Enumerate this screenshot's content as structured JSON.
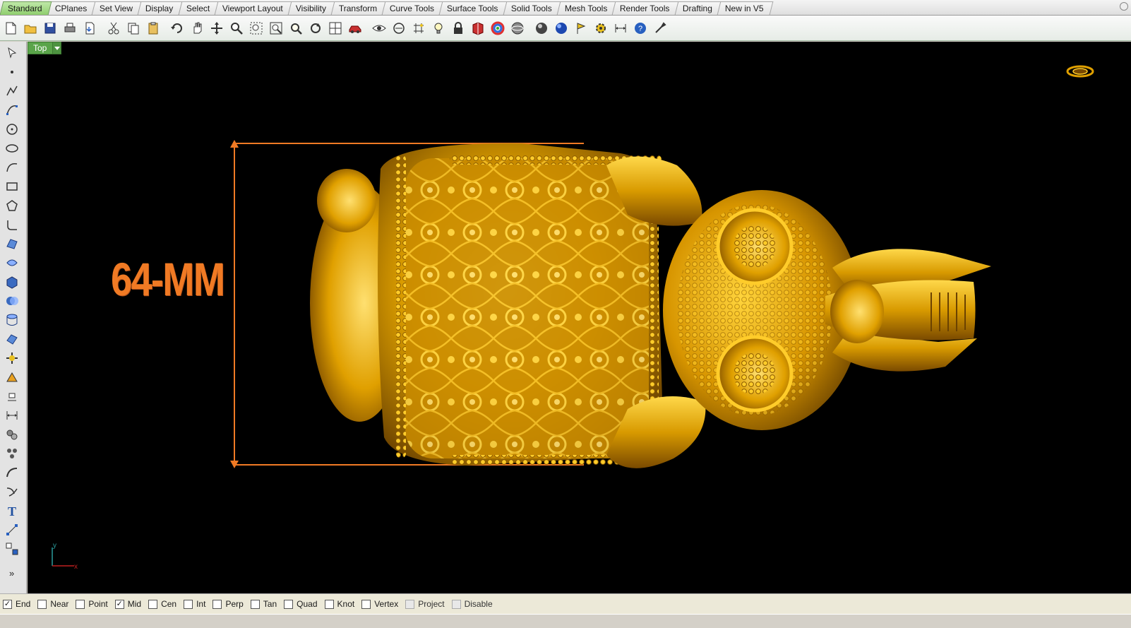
{
  "tabs": [
    {
      "label": "Standard",
      "active": true
    },
    {
      "label": "CPlanes"
    },
    {
      "label": "Set View"
    },
    {
      "label": "Display"
    },
    {
      "label": "Select"
    },
    {
      "label": "Viewport Layout"
    },
    {
      "label": "Visibility"
    },
    {
      "label": "Transform"
    },
    {
      "label": "Curve Tools"
    },
    {
      "label": "Surface Tools"
    },
    {
      "label": "Solid Tools"
    },
    {
      "label": "Mesh Tools"
    },
    {
      "label": "Render Tools"
    },
    {
      "label": "Drafting"
    },
    {
      "label": "New in V5"
    }
  ],
  "toolbar_icons": [
    "new-file-icon",
    "open-folder-icon",
    "save-icon",
    "print-icon",
    "import-icon",
    "cut-icon",
    "copy-icon",
    "paste-icon",
    "undo-icon",
    "pan-hand-icon",
    "move-view-icon",
    "zoom-in-icon",
    "zoom-window-icon",
    "zoom-extents-icon",
    "zoom-selected-icon",
    "rotate-view-icon",
    "four-viewports-icon",
    "car-icon",
    "eye-icon",
    "snap-circle-icon",
    "grid-snap-icon",
    "light-bulb-icon",
    "lock-icon",
    "layer-book-icon",
    "color-wheel-icon",
    "shaded-sphere-icon",
    "rendered-sphere-icon",
    "render-sphere-icon",
    "render-flag-icon",
    "options-gear-icon",
    "dimension-icon",
    "help-icon",
    "tools-icon"
  ],
  "left_tool_icons": [
    "select-arrow-icon",
    "point-icon",
    "polyline-icon",
    "curve-icon",
    "circle-icon",
    "ellipse-icon",
    "arc-icon",
    "rectangle-icon",
    "polygon-icon",
    "fillet-icon",
    "surface-icon",
    "surface-from-curves-icon",
    "box-solid-icon",
    "boolean-icon",
    "extrude-icon",
    "surface-edit-icon",
    "solid-tools-icon",
    "analysis-icon",
    "transform-icon",
    "dimension-icon",
    "group-icon",
    "array-icon",
    "blend-icon",
    "curve-from-object-icon",
    "text-icon",
    "edit-points-icon",
    "block-icon"
  ],
  "left_more_label": "»",
  "viewport": {
    "name": "Top",
    "dimension_label": "64-MM",
    "axis_x": "x",
    "axis_y": "y"
  },
  "osnaps": [
    {
      "label": "End",
      "checked": true
    },
    {
      "label": "Near",
      "checked": false
    },
    {
      "label": "Point",
      "checked": false
    },
    {
      "label": "Mid",
      "checked": true
    },
    {
      "label": "Cen",
      "checked": false
    },
    {
      "label": "Int",
      "checked": false
    },
    {
      "label": "Perp",
      "checked": false
    },
    {
      "label": "Tan",
      "checked": false
    },
    {
      "label": "Quad",
      "checked": false
    },
    {
      "label": "Knot",
      "checked": false
    },
    {
      "label": "Vertex",
      "checked": false
    },
    {
      "label": "Project",
      "checked": false,
      "disabled": true
    },
    {
      "label": "Disable",
      "checked": false,
      "disabled": true
    }
  ],
  "colors": {
    "viewport_bg": "#000000",
    "gold": "#e8a800",
    "dimension": "#f07a24",
    "active_tab": "#8fce6e"
  }
}
